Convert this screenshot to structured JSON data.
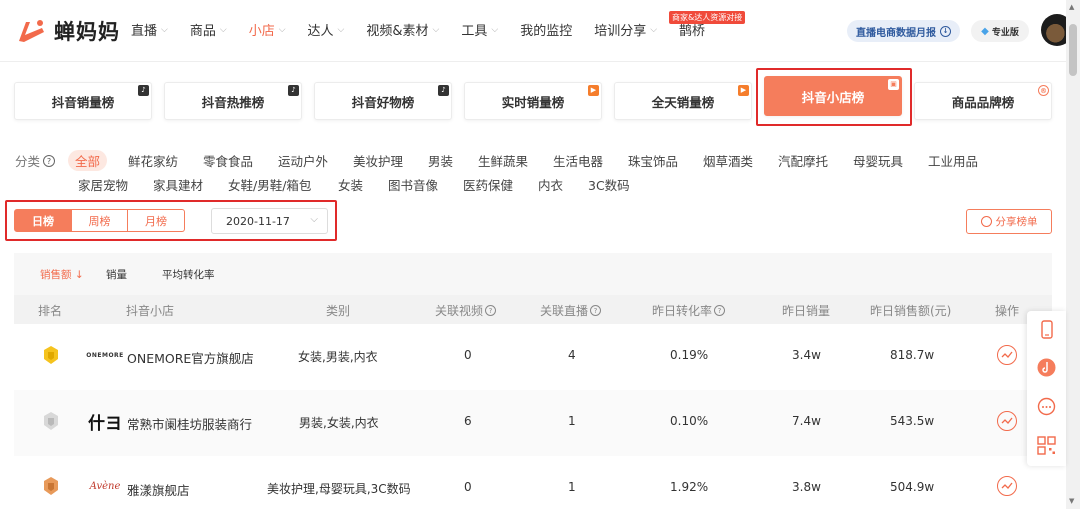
{
  "brand": {
    "name": "蝉妈妈",
    "color": "#f26a4b"
  },
  "nav": {
    "items": [
      {
        "label": "直播",
        "dropdown": true
      },
      {
        "label": "商品",
        "dropdown": true
      },
      {
        "label": "小店",
        "dropdown": true,
        "active": true
      },
      {
        "label": "达人",
        "dropdown": true
      },
      {
        "label": "视频&素材",
        "dropdown": true
      },
      {
        "label": "工具",
        "dropdown": true
      },
      {
        "label": "我的监控",
        "dropdown": false
      },
      {
        "label": "培训分享",
        "dropdown": true
      },
      {
        "label": "鹊桥",
        "dropdown": false
      }
    ],
    "badge": "商家&达人资源对接",
    "report_button": "直播电商数据月报",
    "pro_label": "专业版"
  },
  "rank_tabs": [
    {
      "label": "抖音销量榜",
      "icon": "tiktok-icon"
    },
    {
      "label": "抖音热推榜",
      "icon": "tiktok-icon"
    },
    {
      "label": "抖音好物榜",
      "icon": "tiktok-icon"
    },
    {
      "label": "实时销量榜",
      "icon": "live-icon"
    },
    {
      "label": "全天销量榜",
      "icon": "live-icon"
    },
    {
      "label": "抖音小店榜",
      "icon": "shop-icon",
      "active": true
    },
    {
      "label": "商品品牌榜",
      "icon": "brand-icon"
    }
  ],
  "category": {
    "label": "分类",
    "items": [
      "全部",
      "鲜花家纺",
      "零食食品",
      "运动户外",
      "美妆护理",
      "男装",
      "生鲜蔬果",
      "生活电器",
      "珠宝饰品",
      "烟草酒类",
      "汽配摩托",
      "母婴玩具",
      "工业用品",
      "家居宠物",
      "家具建材",
      "女鞋/男鞋/箱包",
      "女装",
      "图书音像",
      "医药保健",
      "内衣",
      "3C数码"
    ]
  },
  "period": {
    "daily": "日榜",
    "weekly": "周榜",
    "monthly": "月榜"
  },
  "date": "2020-11-17",
  "share_label": "分享榜单",
  "sort": {
    "sales_amount": "销售额",
    "sales_volume": "销量",
    "avg_conversion": "平均转化率"
  },
  "columns": {
    "rank": "排名",
    "shop": "抖音小店",
    "category": "类别",
    "videos": "关联视频",
    "lives": "关联直播",
    "conversion": "昨日转化率",
    "volume": "昨日销量",
    "amount": "昨日销售额(元)",
    "action": "操作"
  },
  "rows": [
    {
      "logo": "ONEMORE",
      "shop": "ONEMORE官方旗舰店",
      "category": "女装,男装,内衣",
      "videos": "0",
      "lives": "4",
      "conversion": "0.19%",
      "volume": "3.4w",
      "amount": "818.7w"
    },
    {
      "logo": "什ヨ",
      "shop": "常熟市阑桂坊服装商行",
      "category": "男装,女装,内衣",
      "videos": "6",
      "lives": "1",
      "conversion": "0.10%",
      "volume": "7.4w",
      "amount": "543.5w"
    },
    {
      "logo": "Avène",
      "shop": "雅漾旗舰店",
      "category": "美妆护理,母婴玩具,3C数码",
      "videos": "0",
      "lives": "1",
      "conversion": "1.92%",
      "volume": "3.8w",
      "amount": "504.9w"
    }
  ]
}
